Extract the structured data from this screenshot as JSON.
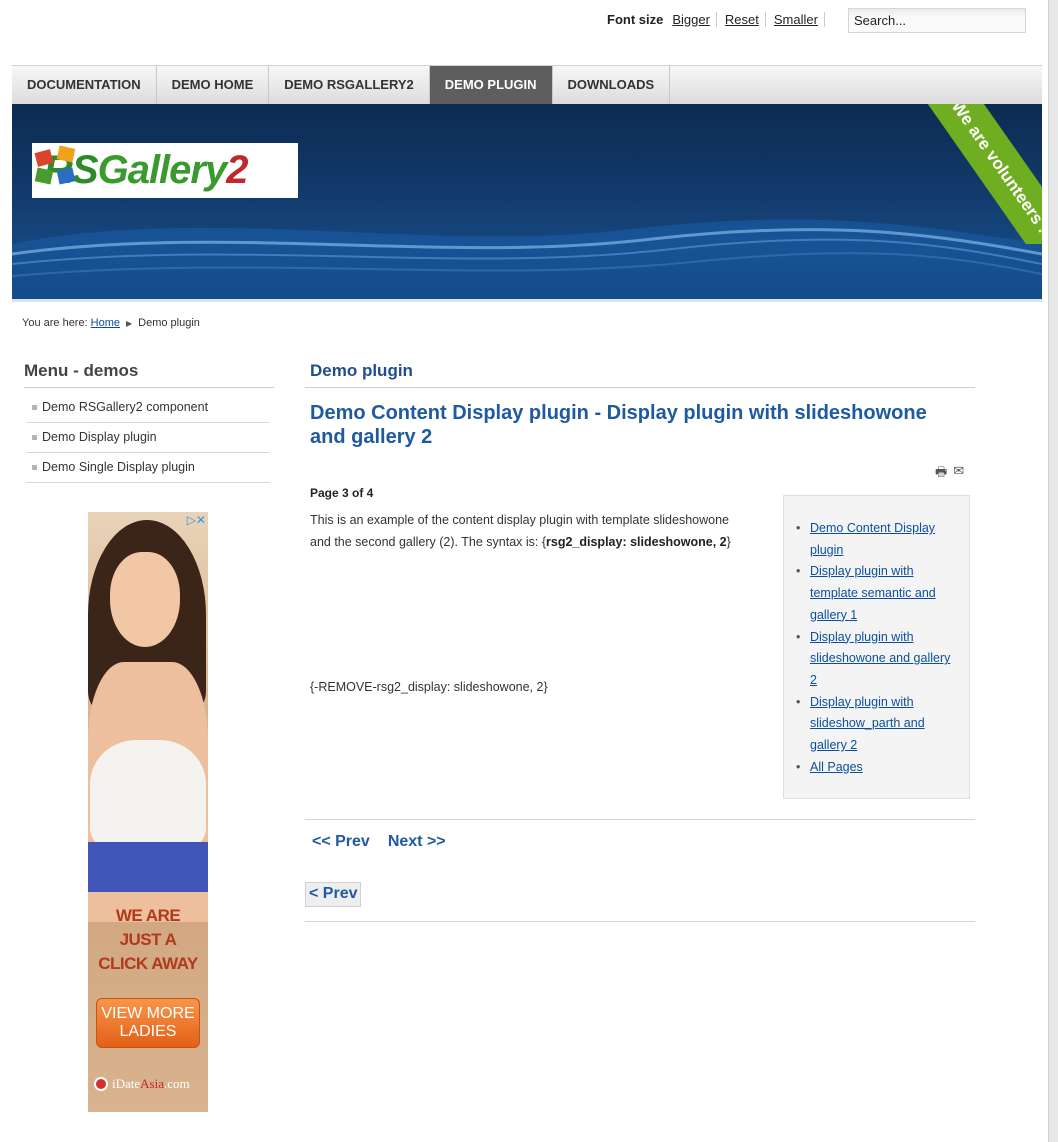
{
  "fontsize": {
    "label": "Font size",
    "bigger": "Bigger",
    "reset": "Reset",
    "smaller": "Smaller"
  },
  "search": {
    "value": "Search..."
  },
  "nav": {
    "items": [
      "DOCUMENTATION",
      "DEMO HOME",
      "DEMO RSGALLERY2",
      "DEMO PLUGIN",
      "DOWNLOADS"
    ],
    "active": "DEMO PLUGIN"
  },
  "banner": {
    "logo_rs": "RS",
    "logo_gallery": "Gallery",
    "logo_two": "2",
    "ribbon": "We are volunteers !"
  },
  "breadcrumb": {
    "prefix": "You are here:",
    "home": "Home",
    "current": "Demo plugin"
  },
  "sidebar": {
    "title": "Menu - demos",
    "items": [
      "Demo RSGallery2 component",
      "Demo Display plugin",
      "Demo Single Display plugin"
    ]
  },
  "ad": {
    "headline_1": "WE ARE",
    "headline_2": "JUST A",
    "headline_3": "CLICK AWAY",
    "button": "VIEW MORE LADIES",
    "brand_1": "iDate",
    "brand_2": "Asia",
    "brand_3": ".com"
  },
  "main": {
    "section_title": "Demo plugin",
    "article_title": "Demo Content Display plugin - Display plugin with slideshowone and gallery 2",
    "page_num": "Page 3 of 4",
    "body_1": "This is an example of the content display plugin with template slideshowone and the second gallery (2). The syntax is: {",
    "body_bold": "rsg2_display: slideshowone, 2",
    "body_2": "}",
    "remove_text": "{-REMOVE-rsg2_display: slideshowone, 2}",
    "toc": [
      "Demo Content Display plugin",
      "Display plugin with template semantic and gallery 1",
      "Display plugin with slideshowone and gallery 2",
      "Display plugin with slideshow_parth and gallery 2",
      "All Pages"
    ],
    "prev": "<< Prev",
    "next": "Next >>",
    "prev_button": "< Prev"
  },
  "colors": {
    "link": "#0b4f9c",
    "title": "#1f5aa0",
    "ribbon": "#6fae21",
    "nav_active": "#5e5e5e"
  }
}
